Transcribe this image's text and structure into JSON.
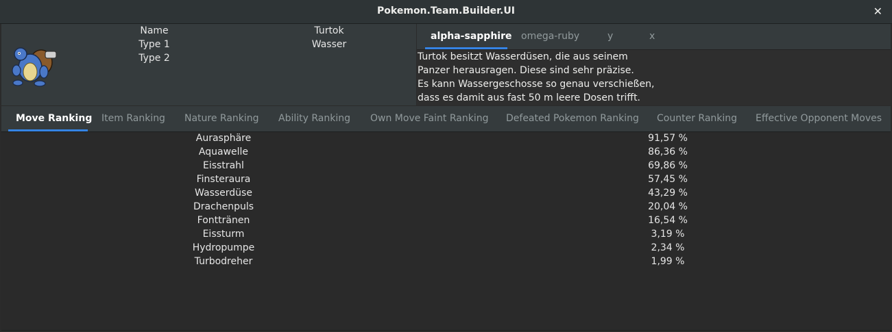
{
  "window": {
    "title": "Pokemon.Team.Builder.UI"
  },
  "pokemon": {
    "labels": [
      "Name",
      "Type 1",
      "Type 2"
    ],
    "name": "Turtok",
    "type1": "Wasser",
    "type2": ""
  },
  "game_tabs": [
    "alpha-sapphire",
    "omega-ruby",
    "y",
    "x"
  ],
  "description": [
    "Turtok besitzt Wasserdüsen, die aus seinem",
    "Panzer herausragen. Diese sind sehr präzise.",
    "Es kann Wassergeschosse so genau verschießen,",
    "dass es damit aus fast 50 m leere Dosen trifft."
  ],
  "ranking_tabs": [
    "Move Ranking",
    "Item Ranking",
    "Nature Ranking",
    "Ability Ranking",
    "Own Move Faint Ranking",
    "Defeated Pokemon Ranking",
    "Counter Ranking",
    "Effective Opponent Moves"
  ],
  "moves": [
    {
      "name": "Aurasphäre",
      "pct": "91,57 %"
    },
    {
      "name": "Aquawelle",
      "pct": "86,36 %"
    },
    {
      "name": "Eisstrahl",
      "pct": "69,86 %"
    },
    {
      "name": "Finsteraura",
      "pct": "57,45 %"
    },
    {
      "name": "Wasserdüse",
      "pct": "43,29 %"
    },
    {
      "name": "Drachenpuls",
      "pct": "20,04 %"
    },
    {
      "name": "Fonttränen",
      "pct": "16,54 %"
    },
    {
      "name": "Eissturm",
      "pct": "3,19 %"
    },
    {
      "name": "Hydropumpe",
      "pct": "2,34 %"
    },
    {
      "name": "Turbodreher",
      "pct": "1,99 %"
    }
  ],
  "colors": {
    "accent": "#3584e4",
    "header": "#2e3436",
    "panel": "#353b3d"
  }
}
